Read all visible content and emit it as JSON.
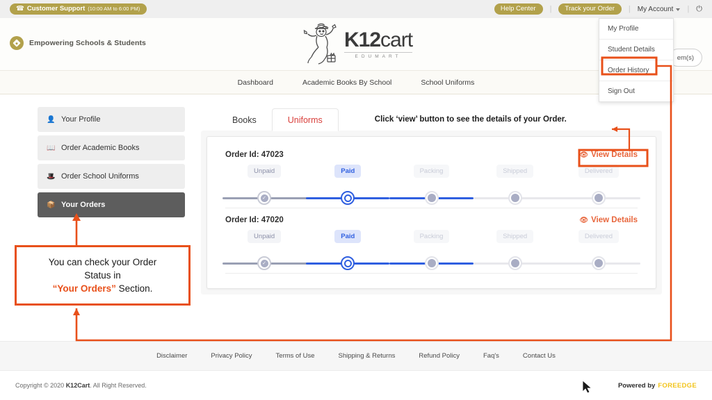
{
  "topbar": {
    "support_label": "Customer Support",
    "support_hours": "(10:00 AM to 6:00 PM)",
    "phone_icon": "phone-icon",
    "help_center": "Help Center",
    "track_order": "Track your Order",
    "my_account": "My Account",
    "power_icon": "power-icon",
    "pill_color": "#b2a14b"
  },
  "brand": {
    "tagline": "Empowering Schools & Students",
    "logo_main_1": "K12",
    "logo_main_2": "cart",
    "logo_sub": "EDUMART",
    "cart_label": "em(s)"
  },
  "nav": {
    "items": [
      {
        "label": "Dashboard"
      },
      {
        "label": "Academic Books By School"
      },
      {
        "label": "School Uniforms"
      }
    ]
  },
  "account_dropdown": {
    "items": [
      {
        "label": "My Profile",
        "highlighted": false
      },
      {
        "label": "Student Details",
        "highlighted": false
      },
      {
        "label": "Order History",
        "highlighted": true
      },
      {
        "label": "Sign Out",
        "highlighted": false
      }
    ]
  },
  "sidebar": {
    "items": [
      {
        "label": "Your Profile",
        "icon": "user-icon",
        "glyph": "♟",
        "active": false
      },
      {
        "label": "Order Academic Books",
        "icon": "book-icon",
        "glyph": "◨",
        "active": false
      },
      {
        "label": "Order School Uniforms",
        "icon": "shirt-icon",
        "glyph": "⬛",
        "active": false
      },
      {
        "label": "Your Orders",
        "icon": "box-icon",
        "glyph": "▣",
        "active": true
      }
    ]
  },
  "main": {
    "tabs": [
      {
        "label": "Books",
        "active": false
      },
      {
        "label": "Uniforms",
        "active": true
      }
    ],
    "hint": "Click ‘view’ button to see the details of your Order.",
    "view_details_label": "View Details",
    "eye_icon": "eye-icon",
    "orders": [
      {
        "order_id_label": "Order Id: 47023",
        "steps": [
          {
            "label": "Unpaid",
            "state": "done"
          },
          {
            "label": "Paid",
            "state": "current"
          },
          {
            "label": "Packing",
            "state": "todo"
          },
          {
            "label": "Shipped",
            "state": "todo"
          },
          {
            "label": "Delivered",
            "state": "todo"
          }
        ]
      },
      {
        "order_id_label": "Order Id: 47020",
        "steps": [
          {
            "label": "Unpaid",
            "state": "done"
          },
          {
            "label": "Paid",
            "state": "current"
          },
          {
            "label": "Packing",
            "state": "todo"
          },
          {
            "label": "Shipped",
            "state": "todo"
          },
          {
            "label": "Delivered",
            "state": "todo"
          }
        ]
      }
    ]
  },
  "footer": {
    "links": [
      {
        "label": "Disclaimer"
      },
      {
        "label": "Privacy Policy"
      },
      {
        "label": "Terms of Use"
      },
      {
        "label": "Shipping & Returns"
      },
      {
        "label": "Refund Policy"
      },
      {
        "label": "Faq's"
      },
      {
        "label": "Contact Us"
      }
    ],
    "copyright_pre": "Copyright © 2020 ",
    "copyright_brand": "K12Cart",
    "copyright_post": ". All Right Reserved.",
    "powered_by": "Powered by",
    "powered_brand": "FOREEDGE"
  },
  "annotation": {
    "callout_line1": "You can check your Order",
    "callout_line2": "Status in",
    "callout_highlight": "“Your Orders”",
    "callout_line3": " Section.",
    "accent_color": "#e8501a"
  }
}
